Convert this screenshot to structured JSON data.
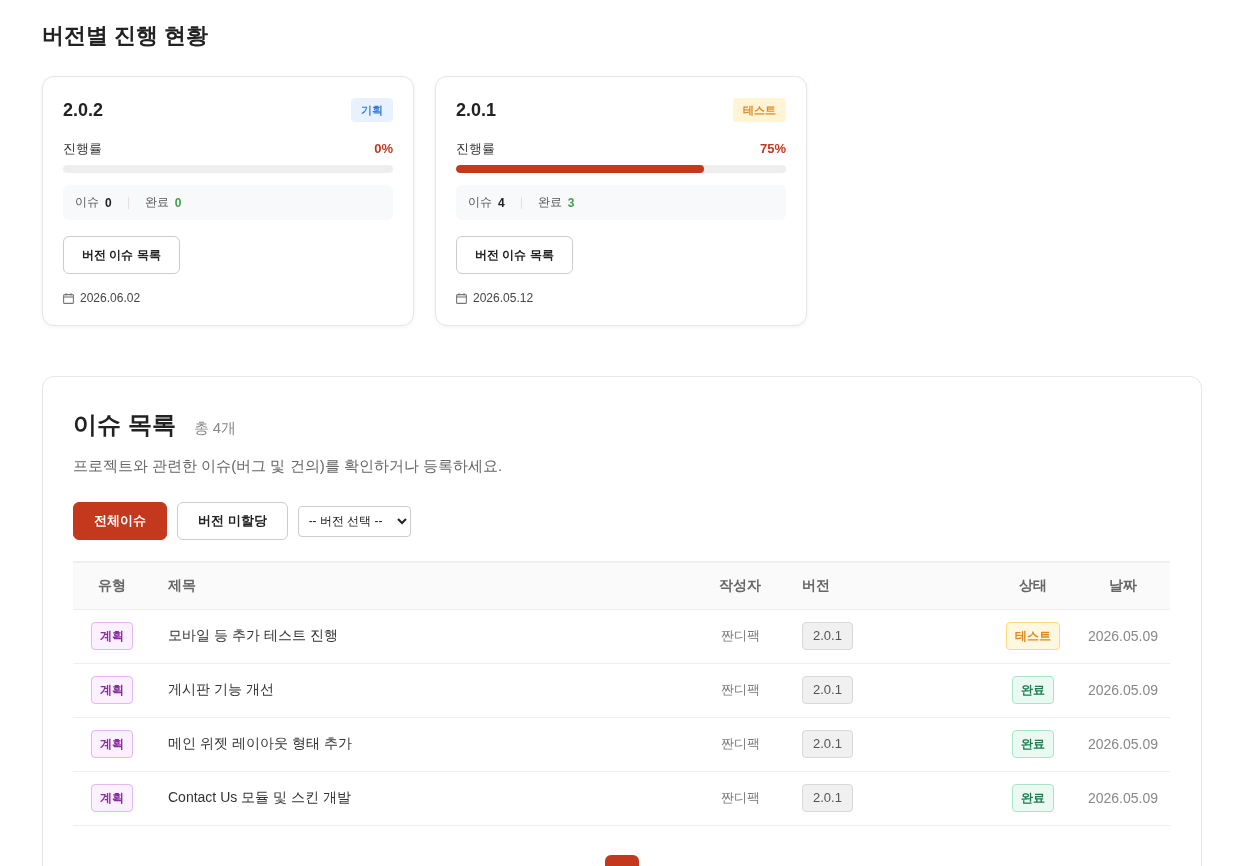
{
  "page_title": "버전별 진행 현황",
  "versions": [
    {
      "name": "2.0.2",
      "stage": {
        "label": "기획",
        "kind": "plan"
      },
      "progress_label": "진행률",
      "progress_text": "0%",
      "level": 0,
      "issues_label": "이슈",
      "issues_count": "0",
      "done_label": "완료",
      "done_count": "0",
      "button": "버전 이슈 목록",
      "date": "2026.06.02"
    },
    {
      "name": "2.0.1",
      "stage": {
        "label": "테스트",
        "kind": "test"
      },
      "progress_label": "진행률",
      "progress_text": "75%",
      "level": 0.75,
      "issues_label": "이슈",
      "issues_count": "4",
      "done_label": "완료",
      "done_count": "3",
      "button": "버전 이슈 목록",
      "date": "2026.05.12"
    }
  ],
  "issues": {
    "title": "이슈 목록",
    "total": "총 4개",
    "description": "프로젝트와 관련한 이슈(버그 및 건의)를 확인하거나 등록하세요.",
    "filters": [
      {
        "label": "전체이슈",
        "selected": true
      },
      {
        "label": "버전 미할당",
        "selected": false
      }
    ],
    "version_select": {
      "value": "-- 버전 선택 --"
    },
    "table": {
      "columns": [
        "유형",
        "제목",
        "작성자",
        "버전",
        "상태",
        "날짜"
      ],
      "rows": [
        {
          "type": {
            "label": "계획",
            "kind": "plan"
          },
          "title": "모바일 등 추가 테스트 진행",
          "author": "짠디팩",
          "version": "2.0.1",
          "status": {
            "label": "테스트",
            "kind": "test"
          },
          "date": "2026.05.09"
        },
        {
          "type": {
            "label": "계획",
            "kind": "plan"
          },
          "title": "게시판 기능 개선",
          "author": "짠디팩",
          "version": "2.0.1",
          "status": {
            "label": "완료",
            "kind": "done"
          },
          "date": "2026.05.09"
        },
        {
          "type": {
            "label": "계획",
            "kind": "plan"
          },
          "title": "메인 위젯 레이아웃 형태 추가",
          "author": "짠디팩",
          "version": "2.0.1",
          "status": {
            "label": "완료",
            "kind": "done"
          },
          "date": "2026.05.09"
        },
        {
          "type": {
            "label": "계획",
            "kind": "plan"
          },
          "title": "Contact Us 모듈 및 스킨 개발",
          "author": "짠디팩",
          "version": "2.0.1",
          "status": {
            "label": "완료",
            "kind": "done"
          },
          "date": "2026.05.09"
        }
      ]
    },
    "pagination": {
      "pages": [
        {
          "selected": true
        }
      ]
    }
  }
}
